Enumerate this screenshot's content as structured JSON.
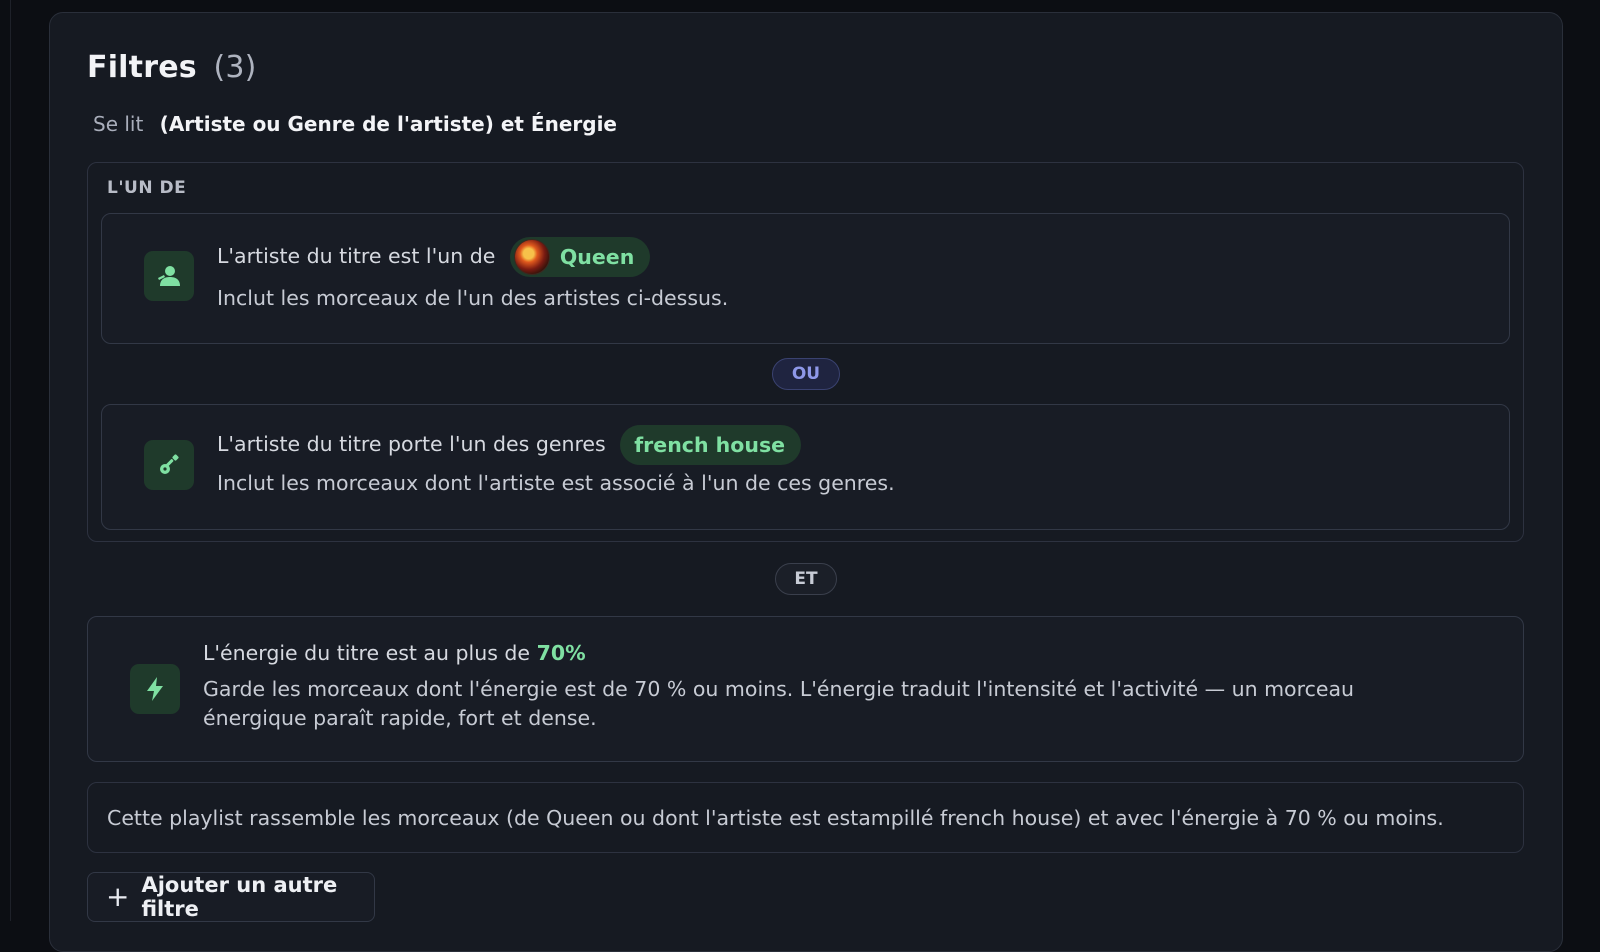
{
  "header": {
    "title": "Filtres",
    "count": "(3)",
    "reads_label": "Se lit",
    "reads_expression": "(Artiste ou Genre de l'artiste) et Énergie"
  },
  "group": {
    "label": "L'UN DE",
    "connector": "OU"
  },
  "filters": [
    {
      "icon": "artist-icon",
      "text": "L'artiste du titre est l'un de",
      "chip": "Queen",
      "description": "Inclut les morceaux de l'un des artistes ci-dessus."
    },
    {
      "icon": "guitar-icon",
      "text": "L'artiste du titre porte l'un des genres",
      "chip": "french house",
      "description": "Inclut les morceaux dont l'artiste est associé à l'un de ces genres."
    },
    {
      "icon": "lightning-icon",
      "text": "L'énergie du titre est au plus de",
      "value": "70%",
      "description_line1": "Garde les morceaux dont l'énergie est de 70 % ou moins. L'énergie traduit l'intensité et l'activité — un morceau",
      "description_line2": "énergique paraît rapide, fort et dense."
    }
  ],
  "and_connector": "ET",
  "summary": "Cette playlist rassemble les morceaux (de Queen ou dont l'artiste est estampillé french house) et avec l'énergie à 70 % ou moins.",
  "add_button": {
    "icon": "plus-icon",
    "label": "Ajouter un autre filtre"
  },
  "colors": {
    "accent_green": "#7fe0a2",
    "chip_bg": "#1f3a2b",
    "or_pill": "#8e98e8",
    "panel_bg": "#161a22"
  }
}
